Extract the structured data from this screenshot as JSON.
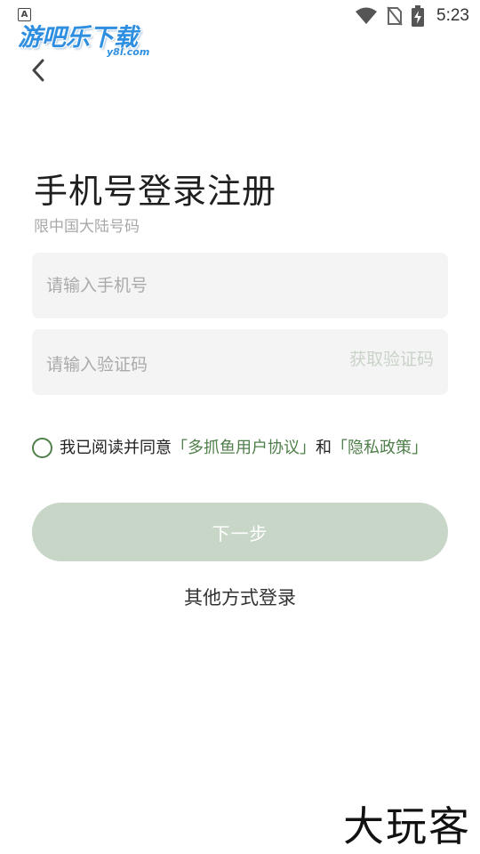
{
  "status_bar": {
    "time": "5:23",
    "notification_icon_label": "A"
  },
  "watermark": {
    "logo_text": "游吧乐下载",
    "logo_subtext": "y8l.com",
    "bottom_text": "大玩客"
  },
  "header": {
    "title": "手机号登录注册",
    "subtitle": "限中国大陆号码"
  },
  "form": {
    "phone_placeholder": "请输入手机号",
    "phone_value": "",
    "code_placeholder": "请输入验证码",
    "code_value": "",
    "get_code_label": "获取验证码"
  },
  "agreement": {
    "prefix": "我已阅读并同意",
    "user_agreement_link": "「多抓鱼用户协议」",
    "conjunction": "和",
    "privacy_policy_link": "「隐私政策」",
    "checked": false
  },
  "actions": {
    "next_label": "下一步",
    "other_login_label": "其他方式登录"
  },
  "colors": {
    "accent_green": "#4f7f4a",
    "next_button_disabled": "#c8d6c8",
    "input_background": "#f4f4f4",
    "placeholder": "#aaaaaa",
    "logo_blue": "#2e8ee0"
  },
  "icons": {
    "back": "chevron-left-icon",
    "wifi": "wifi-icon",
    "no_sim": "no-sim-icon",
    "battery": "battery-charging-icon",
    "checkbox": "radio-circle-icon"
  }
}
